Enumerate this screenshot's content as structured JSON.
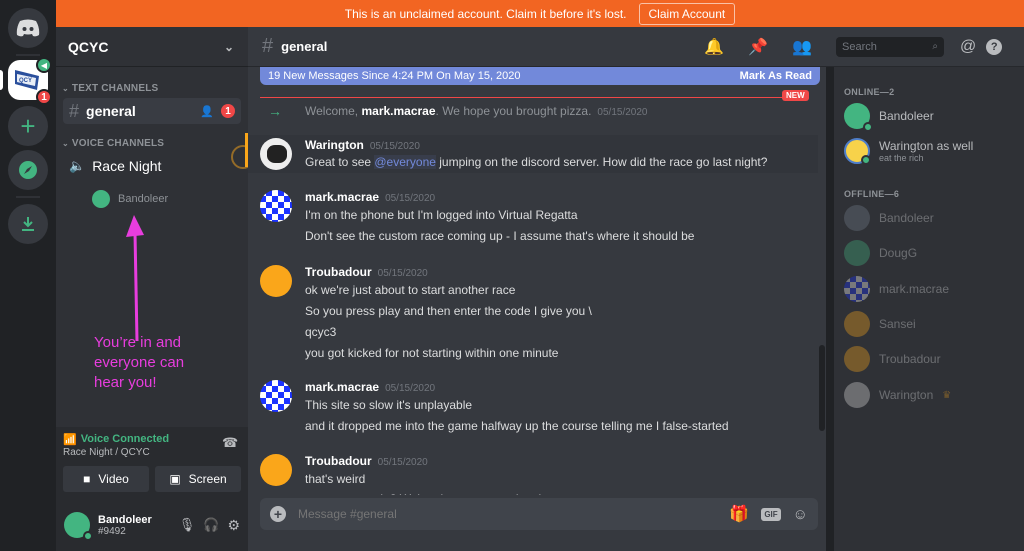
{
  "banner": {
    "text": "This is an unclaimed account. Claim it before it's lost.",
    "button_label": "Claim Account",
    "color": "#f26522"
  },
  "guilds": [
    {
      "name": "Discord Home",
      "icon": "discord-logo-icon"
    },
    {
      "name": "QCYC",
      "icon": "qcyc-flag",
      "badge": "1",
      "voice_active": true
    },
    {
      "name": "Add a Server",
      "icon": "plus-icon"
    },
    {
      "name": "Explore Public Servers",
      "icon": "compass-icon"
    },
    {
      "name": "Download Apps",
      "icon": "download-icon"
    }
  ],
  "server": {
    "name": "QCYC",
    "categories": [
      {
        "label": "TEXT CHANNELS",
        "channels": [
          {
            "name": "general",
            "type": "text",
            "badge": "1",
            "active": true
          }
        ]
      },
      {
        "label": "VOICE CHANNELS",
        "channels": [
          {
            "name": "Race Night",
            "type": "voice",
            "users": [
              "Bandoleer"
            ]
          }
        ]
      }
    ]
  },
  "annotation": {
    "text": "You’re in and everyone can hear you!",
    "color": "#e83dde"
  },
  "voice": {
    "status": "Voice Connected",
    "location": "Race Night / QCYC",
    "video_label": "Video",
    "screen_label": "Screen"
  },
  "user": {
    "name": "Bandoleer",
    "tag": "#9492"
  },
  "chat": {
    "channel": "general",
    "new_messages_bar": "19 New Messages Since 4:24 PM On May 15, 2020",
    "mark_read": "Mark As Read",
    "new_label": "NEW",
    "search_placeholder": "Search",
    "composer_placeholder": "Message #general",
    "gif_label": "GIF",
    "system_message": {
      "prefix": "Welcome, ",
      "user": "mark.macrae",
      "suffix": ". We hope you brought pizza.",
      "timestamp": "05/15/2020"
    },
    "messages": [
      {
        "author": "Warington",
        "timestamp": "05/15/2020",
        "lines": [
          "Great to see ",
          "@everyone",
          " jumping on the discord server. How did the race go last night?"
        ]
      },
      {
        "author": "mark.macrae",
        "timestamp": "05/15/2020",
        "lines": [
          "I'm on the phone but I'm logged into Virtual Regatta",
          "Don't see the custom race coming up - I assume that's where it should be"
        ]
      },
      {
        "author": "Troubadour",
        "timestamp": "05/15/2020",
        "lines": [
          "ok we're just about to start another race",
          "So you press play and then enter the code I give you \\",
          "qcyc3",
          "you got kicked for not starting within one minute"
        ]
      },
      {
        "author": "mark.macrae",
        "timestamp": "05/15/2020",
        "lines": [
          "This site so slow it's unplayable",
          "and it dropped me into the game halfway up the course telling me I false-started"
        ]
      },
      {
        "author": "Troubadour",
        "timestamp": "05/15/2020",
        "lines": [
          "that's weird",
          "wanna try again? We're almost wrapped up here"
        ]
      }
    ]
  },
  "members": {
    "online_label": "ONLINE—2",
    "online": [
      {
        "name": "Bandoleer",
        "avatar_color": "#43b581"
      },
      {
        "name": "Warington as well",
        "status_text": "eat the rich",
        "avatar_color": "#f7d24a"
      }
    ],
    "offline_label": "OFFLINE—6",
    "offline": [
      {
        "name": "Bandoleer",
        "avatar_color": "#747f8d"
      },
      {
        "name": "DougG",
        "avatar_color": "#43b581"
      },
      {
        "name": "mark.macrae",
        "avatar_color": "checker"
      },
      {
        "name": "Sansei",
        "avatar_color": "#faa61a"
      },
      {
        "name": "Troubadour",
        "avatar_color": "#faa61a"
      },
      {
        "name": "Warington",
        "avatar_color": "#ddd",
        "owner": true
      }
    ]
  },
  "colors": {
    "accent": "#7289da",
    "online": "#43b581",
    "danger": "#f04747",
    "troubadour": "#faa61a"
  }
}
